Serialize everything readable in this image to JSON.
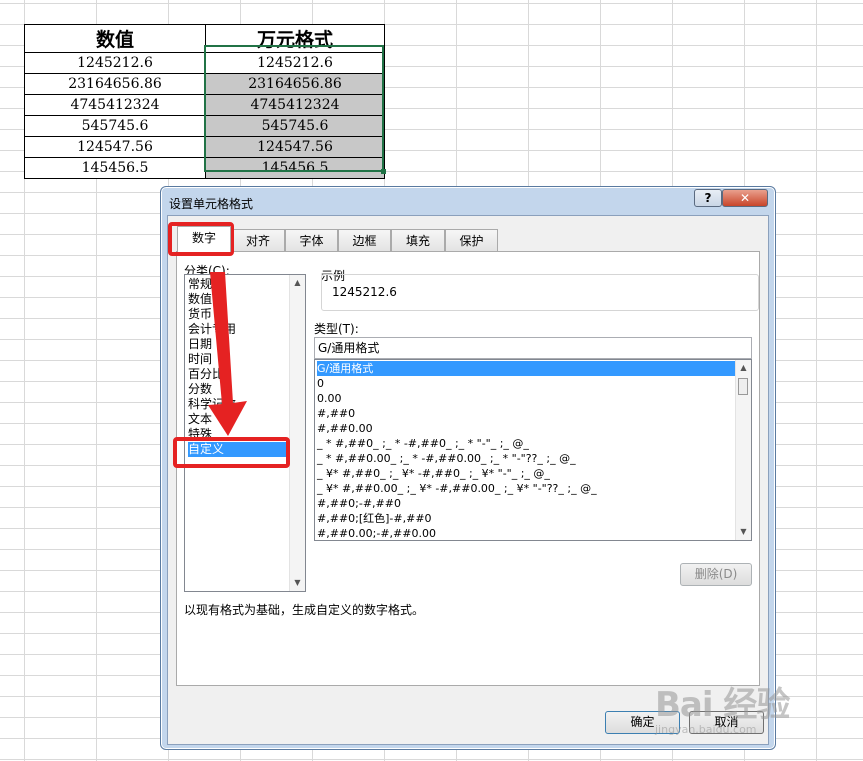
{
  "sheet": {
    "headers": [
      "数值",
      "万元格式"
    ],
    "rows": [
      [
        "1245212.6",
        "1245212.6"
      ],
      [
        "23164656.86",
        "23164656.86"
      ],
      [
        "4745412324",
        "4745412324"
      ],
      [
        "545745.6",
        "545745.6"
      ],
      [
        "124547.56",
        "124547.56"
      ],
      [
        "145456.5",
        "145456.5"
      ]
    ]
  },
  "dialog": {
    "title": "设置单元格格式",
    "help_label": "?",
    "close_label": "✕",
    "tabs": [
      "数字",
      "对齐",
      "字体",
      "边框",
      "填充",
      "保护"
    ],
    "active_tab": "数字",
    "category_label": "分类(C):",
    "categories": [
      "常规",
      "数值",
      "货币",
      "会计专用",
      "日期",
      "时间",
      "百分比",
      "分数",
      "科学记数",
      "文本",
      "特殊",
      "自定义"
    ],
    "selected_category": "自定义",
    "sample_label": "示例",
    "sample_value": "1245212.6",
    "type_label": "类型(T):",
    "type_value": "G/通用格式",
    "type_items": [
      "G/通用格式",
      "0",
      "0.00",
      "#,##0",
      "#,##0.00",
      "_ * #,##0_ ;_ * -#,##0_ ;_ * \"-\"_ ;_ @_",
      "_ * #,##0.00_ ;_ * -#,##0.00_ ;_ * \"-\"??_ ;_ @_",
      "_ ¥* #,##0_ ;_ ¥* -#,##0_ ;_ ¥* \"-\"_ ;_ @_",
      "_ ¥* #,##0.00_ ;_ ¥* -#,##0.00_ ;_ ¥* \"-\"??_ ;_ @_",
      "#,##0;-#,##0",
      "#,##0;[红色]-#,##0",
      "#,##0.00;-#,##0.00"
    ],
    "delete_label": "删除(D)",
    "description": "以现有格式为基础，生成自定义的数字格式。",
    "ok_label": "确定",
    "cancel_label": "取消"
  },
  "annotation": {
    "highlight_color": "#e52222"
  },
  "watermark": {
    "text": "Bai 经验",
    "sub": "jingyan.baidu.com"
  }
}
